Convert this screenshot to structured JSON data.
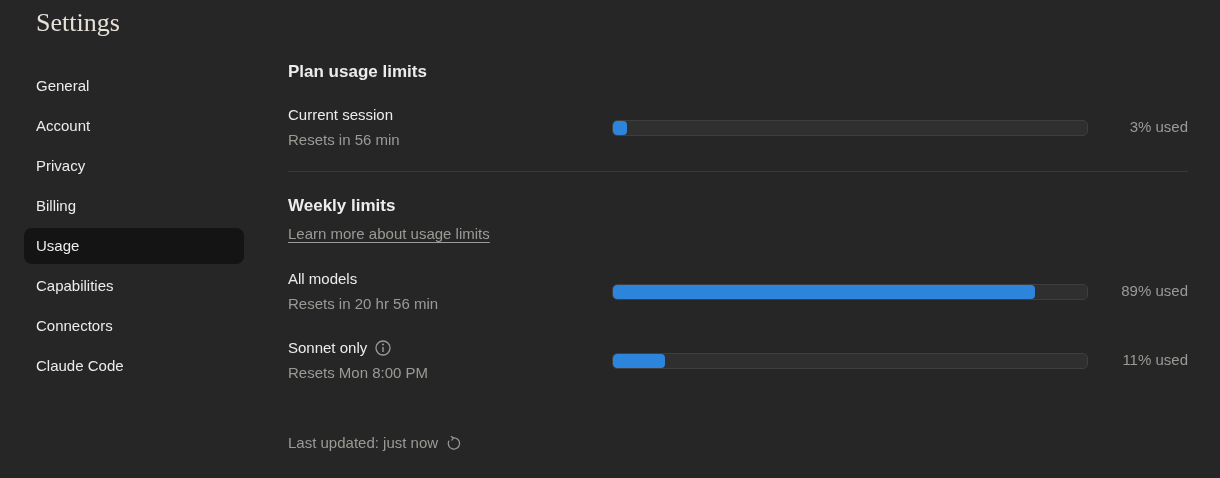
{
  "title": "Settings",
  "sidebar": {
    "items": [
      {
        "label": "General",
        "selected": false
      },
      {
        "label": "Account",
        "selected": false
      },
      {
        "label": "Privacy",
        "selected": false
      },
      {
        "label": "Billing",
        "selected": false
      },
      {
        "label": "Usage",
        "selected": true
      },
      {
        "label": "Capabilities",
        "selected": false
      },
      {
        "label": "Connectors",
        "selected": false
      },
      {
        "label": "Claude Code",
        "selected": false
      }
    ]
  },
  "sections": [
    {
      "title": "Plan usage limits",
      "limits": [
        {
          "name": "Current session",
          "resets": "Resets in 56 min",
          "level": 0.03,
          "reading": "3% used",
          "has_info": false
        }
      ]
    },
    {
      "title": "Weekly limits",
      "link": "Learn more about usage limits",
      "limits": [
        {
          "name": "All models",
          "resets": "Resets in 20 hr 56 min",
          "level": 0.89,
          "reading": "89% used",
          "has_info": false
        },
        {
          "name": "Sonnet only",
          "resets": "Resets Mon 8:00 PM",
          "level": 0.11,
          "reading": "11% used",
          "has_info": true
        }
      ]
    }
  ],
  "last_updated": "Last updated: just now"
}
